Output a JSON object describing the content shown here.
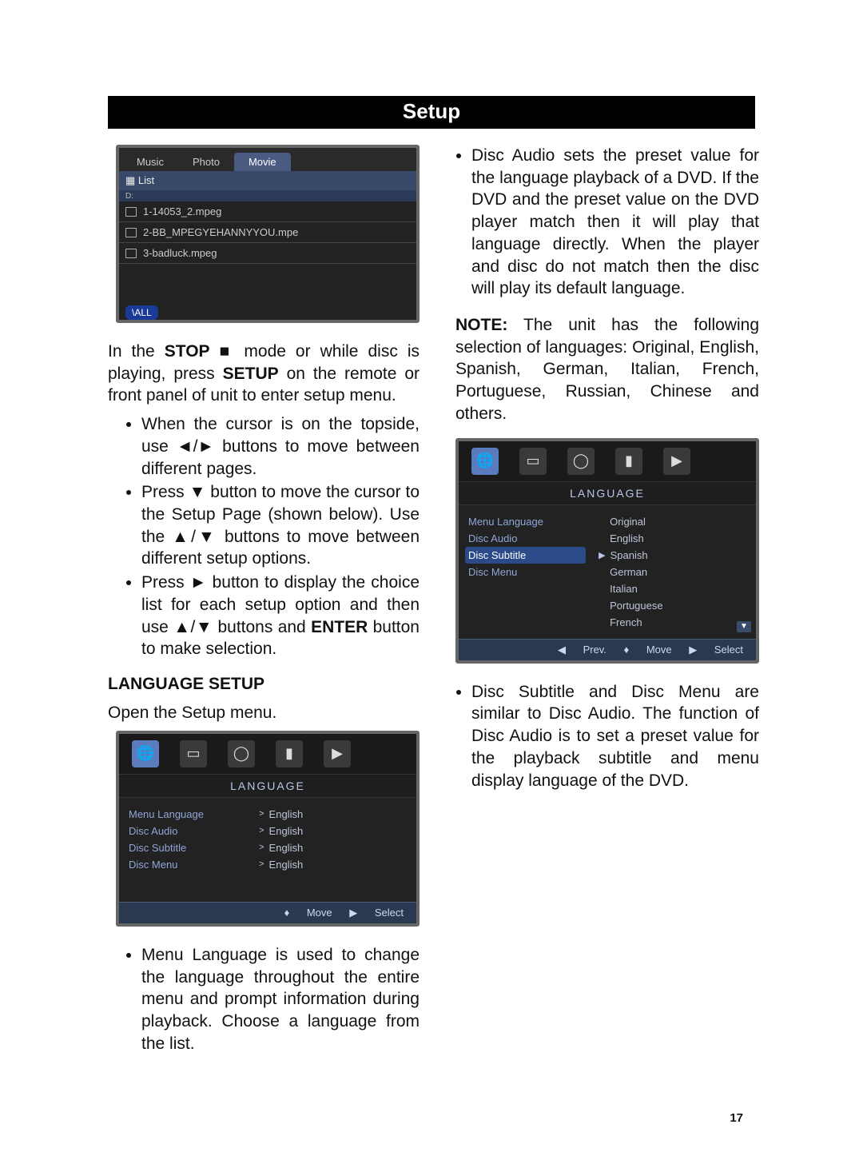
{
  "title": "Setup",
  "page_number": "17",
  "screenshot1": {
    "tabs": [
      "Music",
      "Photo",
      "Movie"
    ],
    "list_label": "List",
    "sub_label": "D:",
    "files": [
      "1-14053_2.mpeg",
      "2-BB_MPEGYEHANNYYOU.mpe",
      "3-badluck.mpeg"
    ],
    "badge": "\\ALL"
  },
  "intro": "In the STOP ■ mode or while disc is playing, press SETUP on the remote or front panel of unit to enter setup menu.",
  "intro_bullets": [
    "When the cursor is on the topside, use ◄/► buttons to move between different pages.",
    "Press ▼ button to move the cursor to the Setup Page (shown below). Use the ▲/▼ buttons to move between different setup options.",
    "Press ► button to display the choice list for each setup option and then use ▲/▼ buttons and ENTER button to make selection."
  ],
  "lang_setup_heading": "LANGUAGE SETUP",
  "open_setup": "Open the Setup menu.",
  "screenshot2": {
    "panel_title": "LANGUAGE",
    "labels": [
      "Menu Language",
      "Disc Audio",
      "Disc Subtitle",
      "Disc Menu"
    ],
    "values": [
      "English",
      "English",
      "English",
      "English"
    ],
    "footer": {
      "move": "Move",
      "select": "Select"
    }
  },
  "bullet_menu_lang": "Menu Language is used to change the language throughout the entire menu and prompt information during playback. Choose a language from the list.",
  "bullet_disc_audio": "Disc Audio sets the preset value for the language playback of a DVD. If the DVD and the preset value on the DVD player match then it will play that language directly. When the player and disc do not match then the disc will play its default language.",
  "note_label": "NOTE:",
  "note_text": " The unit has the following selection of languages: Original, English, Spanish, German, Italian, French, Portuguese, Russian, Chinese and others.",
  "screenshot3": {
    "panel_title": "LANGUAGE",
    "labels": [
      "Menu Language",
      "Disc Audio",
      "Disc Subtitle",
      "Disc Menu"
    ],
    "selected_index": 2,
    "values": [
      "Original",
      "English",
      "Spanish",
      "German",
      "Italian",
      "Portuguese",
      "French"
    ],
    "value_selected_index": 2,
    "footer": {
      "prev": "Prev.",
      "move": "Move",
      "select": "Select"
    }
  },
  "bullet_disc_subtitle": "Disc Subtitle and Disc Menu are similar to Disc Audio. The function of Disc Audio is to set a preset value for the playback subtitle and menu display language of the DVD."
}
